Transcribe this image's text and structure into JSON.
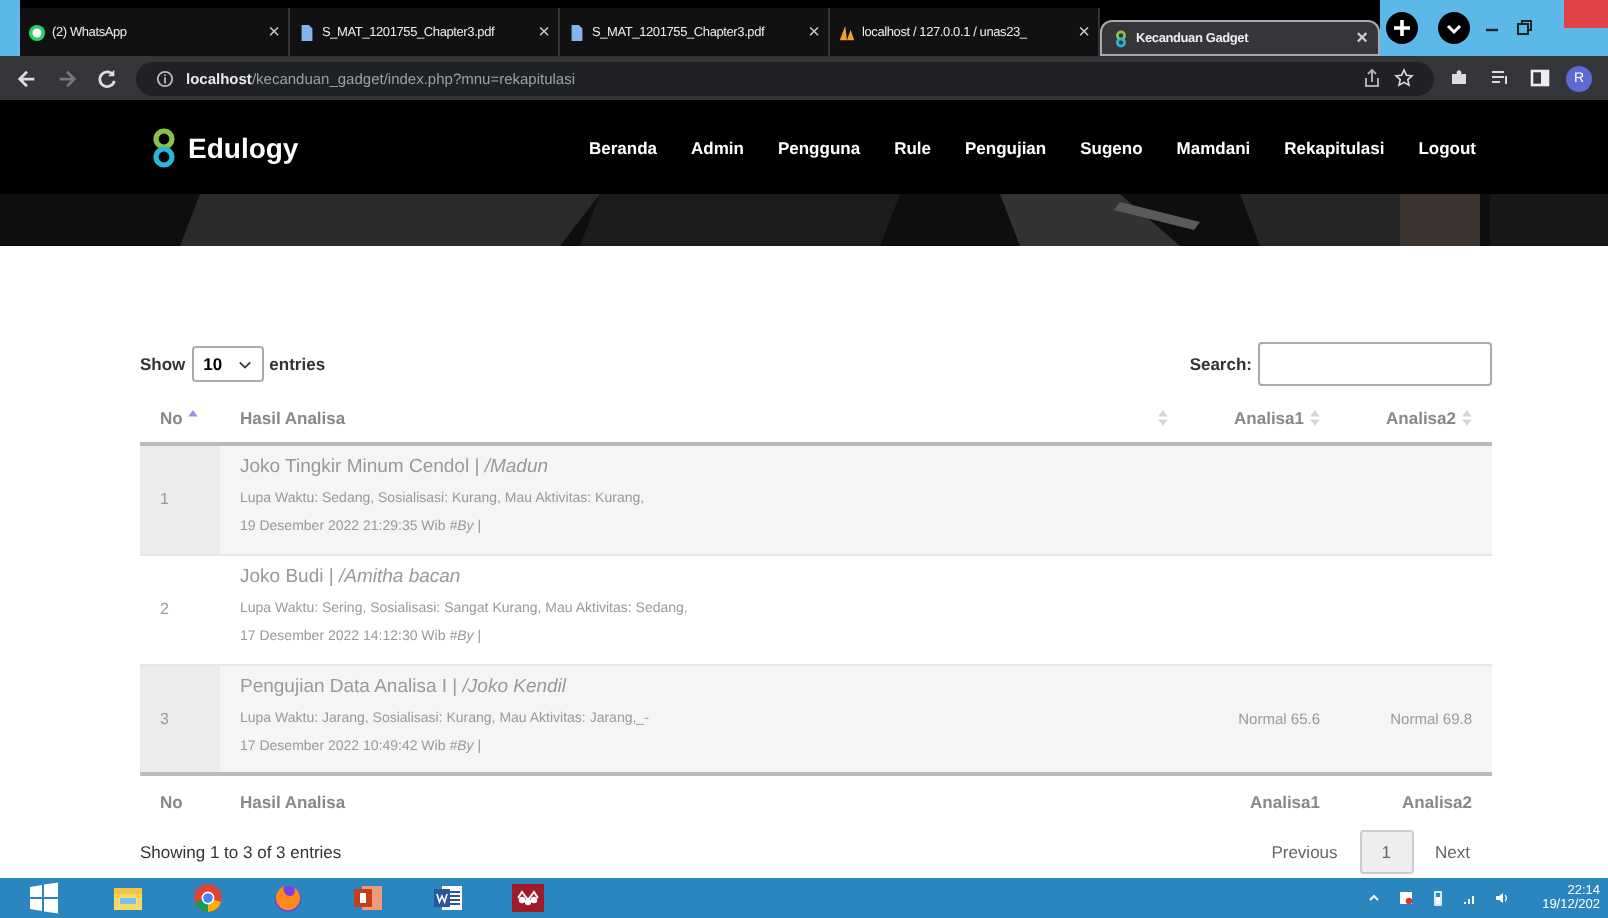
{
  "browser": {
    "tabs": [
      {
        "title": "(2) WhatsApp",
        "selected": false
      },
      {
        "title": "S_MAT_1201755_Chapter3.pdf",
        "selected": false
      },
      {
        "title": "S_MAT_1201755_Chapter3.pdf",
        "selected": false
      },
      {
        "title": "localhost / 127.0.0.1 / unas23_",
        "selected": false
      },
      {
        "title": "Kecanduan Gadget",
        "selected": true
      }
    ],
    "close_glyph": "×",
    "url_host": "localhost",
    "url_path": "/kecanduan_gadget/index.php?mnu=rekapitulasi",
    "profile": "R"
  },
  "navbar": {
    "brand": "Edulogy",
    "links": [
      "Beranda",
      "Admin",
      "Pengguna",
      "Rule",
      "Pengujian",
      "Sugeno",
      "Mamdani",
      "Rekapitulasi",
      "Logout"
    ]
  },
  "table": {
    "length_label_before": "Show",
    "length_value": "10",
    "length_label_after": "entries",
    "search_label": "Search:",
    "columns": [
      "No",
      "Hasil Analisa",
      "Analisa1",
      "Analisa2"
    ],
    "rows": [
      {
        "no": "1",
        "title": "Joko Tingkir Minum Cendol | */Madun*",
        "detail": "Lupa Waktu: Sedang, Sosialisasi: Kurang, Mau Aktivitas: Kurang,",
        "date": "19 Desember 2022 21:29:35 Wib *#By* |",
        "analisa1": "",
        "analisa2": ""
      },
      {
        "no": "2",
        "title": "Joko Budi | */Amitha bacan*",
        "detail": "Lupa Waktu: Sering, Sosialisasi: Sangat Kurang, Mau Aktivitas: Sedang,",
        "date": "17 Desember 2022 14:12:30 Wib *#By* |",
        "analisa1": "",
        "analisa2": ""
      },
      {
        "no": "3",
        "title": "Pengujian Data Analisa I | */Joko Kendil*",
        "detail": "Lupa Waktu: Jarang, Sosialisasi: Kurang, Mau Aktivitas: Jarang,_-",
        "date": "17 Desember 2022 10:49:42 Wib *#By* |",
        "analisa1": "Normal 65.6",
        "analisa2": "Normal 69.8"
      }
    ],
    "footer": [
      "No",
      "Hasil Analisa",
      "Analisa1",
      "Analisa2"
    ],
    "info": "Showing 1 to 3 of 3 entries",
    "pagination": [
      {
        "label": "Previous",
        "selected": false
      },
      {
        "label": "1",
        "selected": true
      },
      {
        "label": "Next",
        "selected": false
      }
    ]
  },
  "taskbar": {
    "time": "22:14",
    "date": "19/12/202"
  }
}
